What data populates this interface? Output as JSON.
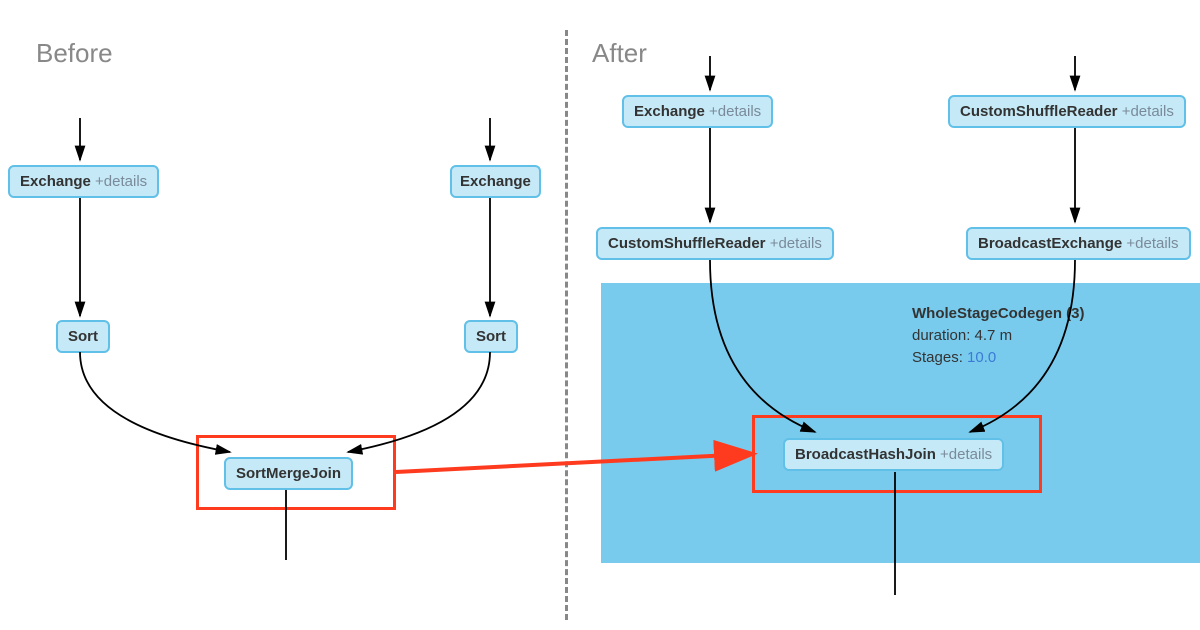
{
  "titles": {
    "before": "Before",
    "after": "After"
  },
  "details_label": "+details",
  "before": {
    "exchange1": "Exchange",
    "exchange2": "Exchange",
    "sort1": "Sort",
    "sort2": "Sort",
    "join": "SortMergeJoin"
  },
  "after": {
    "exchange": "Exchange",
    "csr_top": "CustomShuffleReader",
    "csr_left": "CustomShuffleReader",
    "bcast_ex": "BroadcastExchange",
    "bhj": "BroadcastHashJoin",
    "codegen": {
      "title": "WholeStageCodegen (3)",
      "duration_label": "duration:",
      "duration_value": "4.7 m",
      "stages_label": "Stages:",
      "stages_value": "10.0"
    }
  }
}
